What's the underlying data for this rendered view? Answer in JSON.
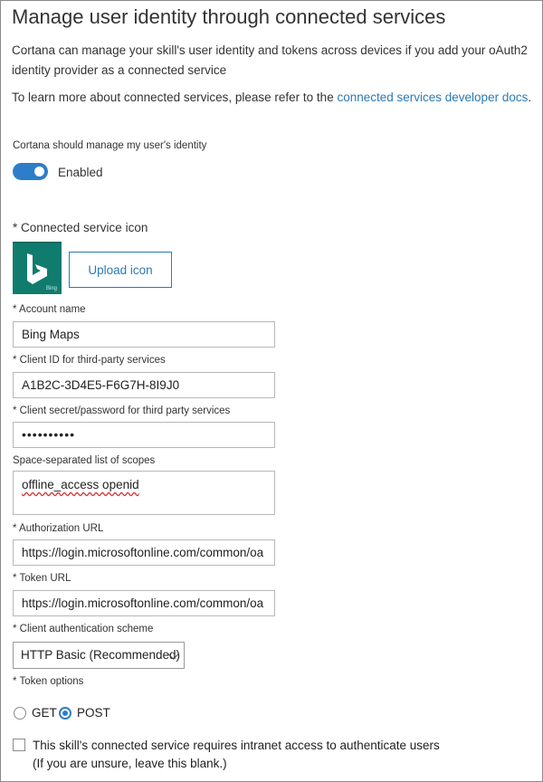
{
  "header": {
    "title": "Manage user identity through connected services"
  },
  "intro": {
    "line1": "Cortana can manage your skill's user identity and tokens across devices if you add your oAuth2",
    "line2": "identity provider as a connected service",
    "learn_prefix": "To learn more about connected services, please refer to the",
    "learn_link": "connected services developer docs",
    "learn_suffix": "."
  },
  "manage_identity": {
    "label": "Cortana should manage my user's identity",
    "toggle_on": true,
    "toggle_text": "Enabled"
  },
  "service_icon": {
    "label": "* Connected service icon",
    "icon_glyph": "b",
    "icon_caption": "Bing",
    "upload_label": "Upload icon"
  },
  "fields": {
    "account_name": {
      "label": "* Account name",
      "value": "Bing Maps"
    },
    "client_id": {
      "label": "* Client ID for third-party services",
      "value": "A1B2C-3D4E5-F6G7H-8I9J0"
    },
    "client_secret": {
      "label": "* Client secret/password for third party services",
      "value": "••••••••••"
    },
    "scopes": {
      "label": "Space-separated list of scopes",
      "value": "offline_access openid"
    },
    "auth_url": {
      "label": "* Authorization URL",
      "value": "https://login.microsoftonline.com/common/oa"
    },
    "token_url": {
      "label": "* Token URL",
      "value": "https://login.microsoftonline.com/common/oa"
    },
    "auth_scheme": {
      "label": "* Client authentication scheme",
      "value": "HTTP Basic (Recommended)"
    }
  },
  "token_options": {
    "label": "* Token options",
    "options": [
      "GET",
      "POST"
    ],
    "selected": "POST"
  },
  "intranet": {
    "checked": false,
    "line1": "This skill's connected service requires intranet access to authenticate users",
    "line2": "(If you are unsure, leave this blank.)"
  },
  "colors": {
    "accent": "#2d7dc8",
    "link": "#2a7ab8",
    "icon_bg": "#0f7c6e"
  }
}
